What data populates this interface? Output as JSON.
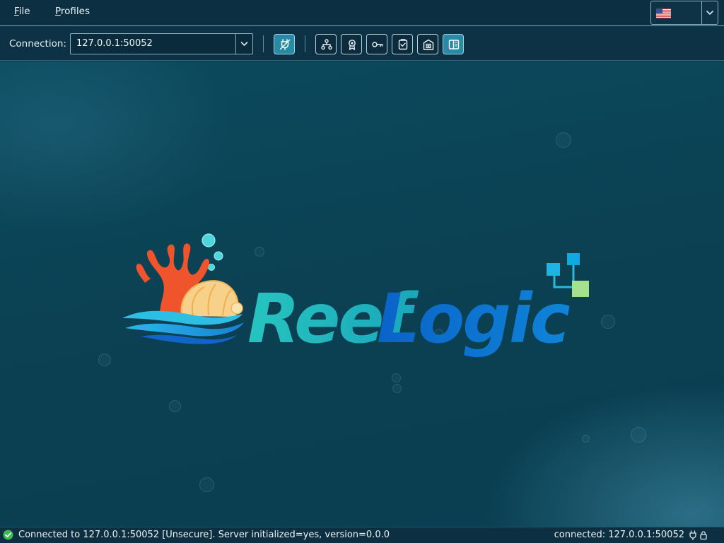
{
  "menubar": {
    "items": [
      {
        "mnemonic": "F",
        "rest": "ile"
      },
      {
        "mnemonic": "P",
        "rest": "rofiles"
      }
    ],
    "language": {
      "selected_icon": "us-flag-icon"
    }
  },
  "toolbar": {
    "connection_label": "Connection:",
    "connection_value": "127.0.0.1:50052",
    "buttons": [
      {
        "icon": "disconnect-plug-icon",
        "active": true
      },
      {
        "icon": "topology-icon",
        "active": false
      },
      {
        "icon": "certificate-icon",
        "active": false
      },
      {
        "icon": "key-icon",
        "active": false
      },
      {
        "icon": "clipboard-check-icon",
        "active": false
      },
      {
        "icon": "vault-icon",
        "active": false
      },
      {
        "icon": "panel-toggle-icon",
        "active": true
      }
    ]
  },
  "logo": {
    "word1": "Reef",
    "word2": "Logic",
    "colors": {
      "reef": "#1fb5b8",
      "logic": "#0d6fd0",
      "coral": "#f0542c"
    }
  },
  "status": {
    "message": "Connected to 127.0.0.1:50052 [Unsecure]. Server initialized=yes, version=0.0.0",
    "right": "connected: 127.0.0.1:50052",
    "ok_color": "#3fb950"
  }
}
